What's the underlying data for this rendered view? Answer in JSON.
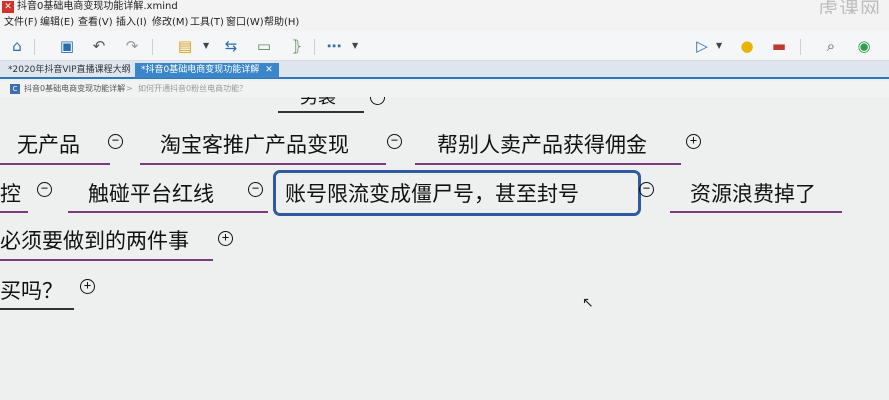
{
  "window": {
    "title": "抖音0基础电商变现功能详解.xmind",
    "watermark": "虎课网"
  },
  "menu": [
    "文件(F)",
    "编辑(E)",
    "查看(V)",
    "插入(I)",
    "修改(M)",
    "工具(T)",
    "窗口(W)",
    "帮助(H)"
  ],
  "tabs": [
    {
      "label": "*2020年抖音VIP直播课程大纲"
    },
    {
      "label": "*抖音0基础电商变现功能详解",
      "close": "✕"
    }
  ],
  "breadcrumb": {
    "root": "抖音0基础电商变现功能详解",
    "sep": ">",
    "current": "如何开通抖音0粉丝电商功能？"
  },
  "nodes": {
    "top_partial": "男装",
    "r1a": "无产品",
    "r1b": "淘宝客推广产品变现",
    "r1c": "帮别人卖产品获得佣金",
    "r2a": "控",
    "r2b": "触碰平台红线",
    "r2c": "账号限流变成僵尸号，甚至封号",
    "r2d": "资源浪费掉了",
    "r3a": "必须要做到的两件事",
    "r4a": "买吗？"
  },
  "toggles": {
    "minus": "−",
    "plus": "+"
  },
  "colors": {
    "line_purple": "#7a3a7e",
    "select_blue": "#2f5aa0",
    "tab_active": "#3a86c8"
  }
}
